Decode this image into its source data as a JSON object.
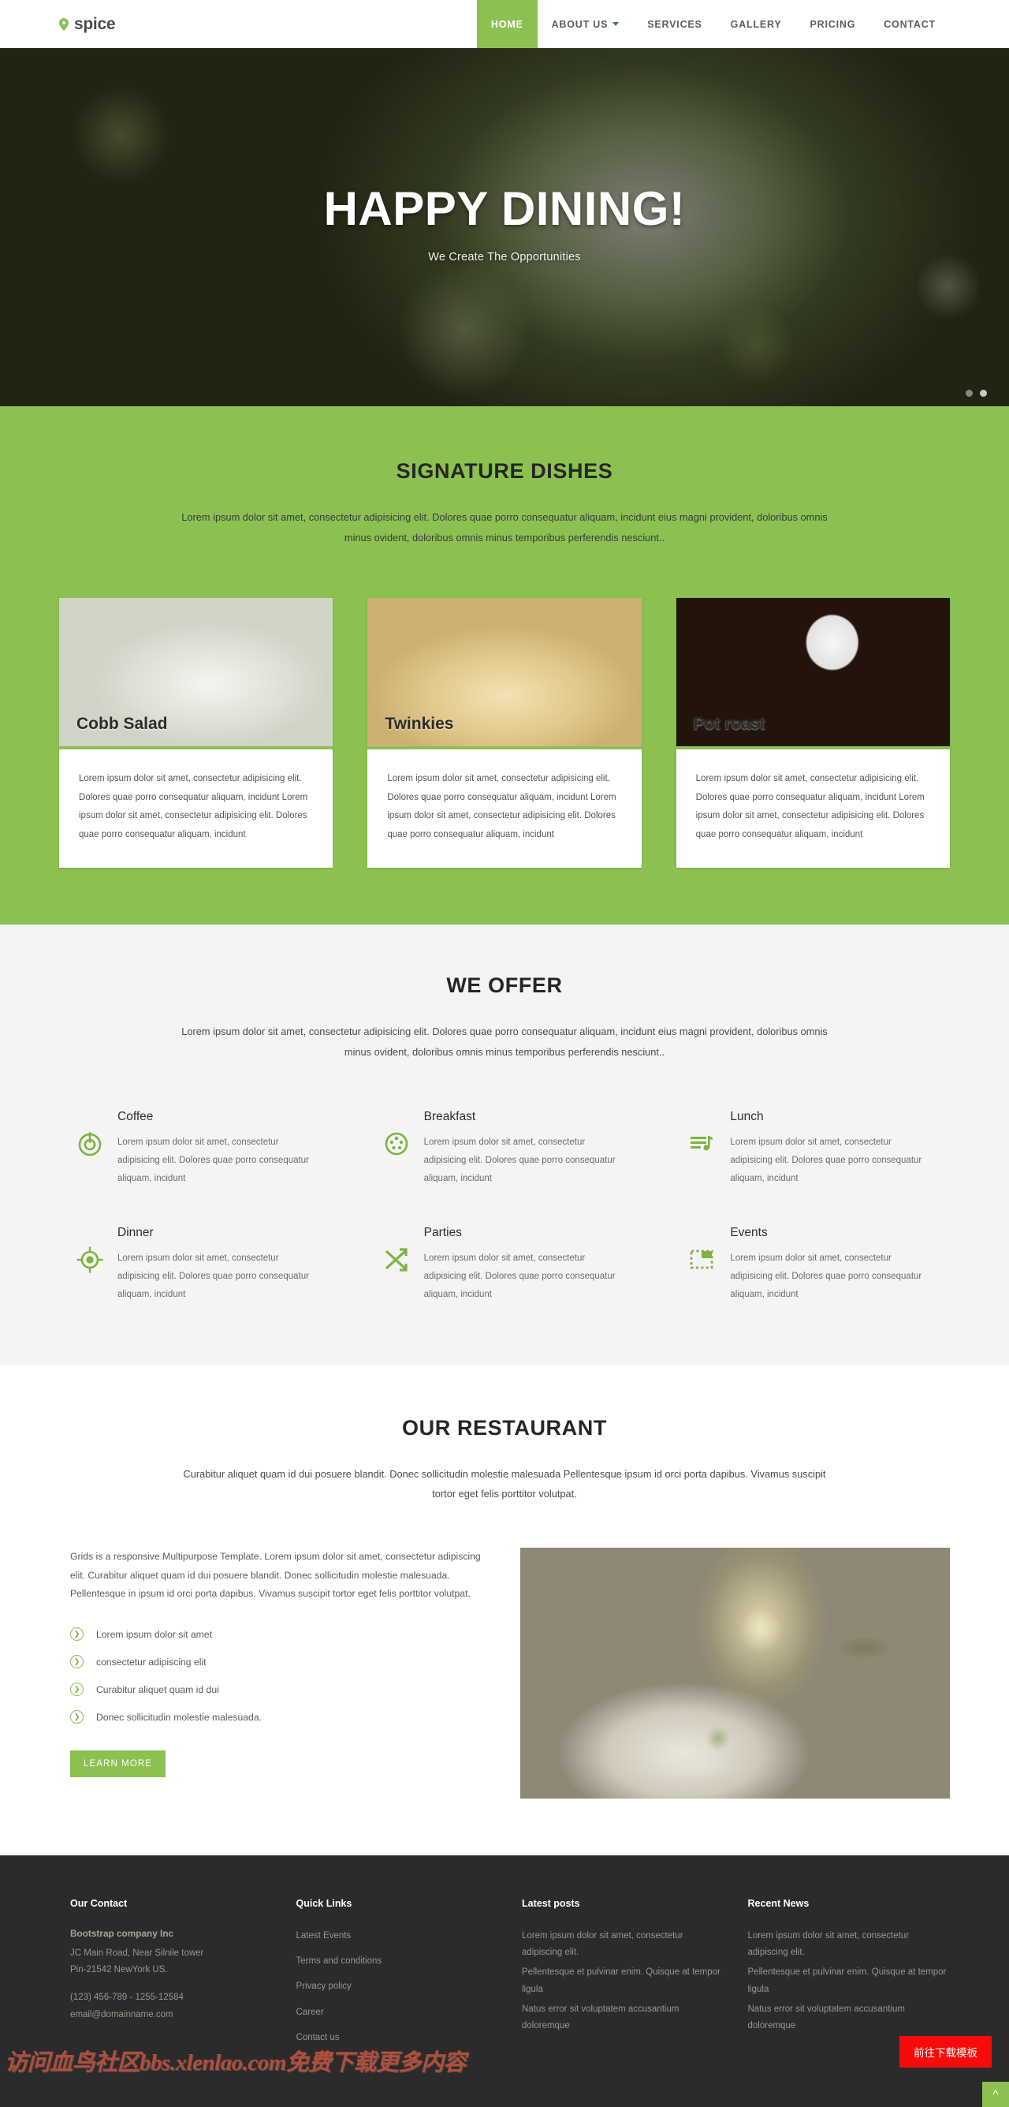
{
  "brand": {
    "name": "spice",
    "icon": "map-pin-icon"
  },
  "nav": {
    "items": [
      {
        "label": "HOME",
        "active": true
      },
      {
        "label": "ABOUT US",
        "caret": true
      },
      {
        "label": "SERVICES"
      },
      {
        "label": "GALLERY"
      },
      {
        "label": "PRICING"
      },
      {
        "label": "CONTACT"
      }
    ]
  },
  "hero": {
    "title": "HAPPY DINING!",
    "subtitle": "We Create The Opportunities",
    "dots": 2
  },
  "dishes": {
    "title": "SIGNATURE DISHES",
    "subtitle": "Lorem ipsum dolor sit amet, consectetur adipisicing elit. Dolores quae porro consequatur aliquam, incidunt eius magni provident, doloribus omnis minus ovident, doloribus omnis minus temporibus perferendis nesciunt..",
    "cards": [
      {
        "name": "Cobb Salad",
        "body": "Lorem ipsum dolor sit amet, consectetur adipisicing elit. Dolores quae porro consequatur aliquam, incidunt Lorem ipsum dolor sit amet, consectetur adipisicing elit. Dolores quae porro consequatur aliquam, incidunt"
      },
      {
        "name": "Twinkies",
        "body": "Lorem ipsum dolor sit amet, consectetur adipisicing elit. Dolores quae porro consequatur aliquam, incidunt Lorem ipsum dolor sit amet, consectetur adipisicing elit. Dolores quae porro consequatur aliquam, incidunt"
      },
      {
        "name": "Pot roast",
        "body": "Lorem ipsum dolor sit amet, consectetur adipisicing elit. Dolores quae porro consequatur aliquam, incidunt Lorem ipsum dolor sit amet, consectetur adipisicing elit. Dolores quae porro consequatur aliquam, incidunt"
      }
    ]
  },
  "offer": {
    "title": "WE OFFER",
    "subtitle": "Lorem ipsum dolor sit amet, consectetur adipisicing elit. Dolores quae porro consequatur aliquam, incidunt eius magni provident, doloribus omnis minus ovident, doloribus omnis minus temporibus perferendis nesciunt..",
    "items": [
      {
        "title": "Coffee",
        "icon": "power-circle-icon",
        "body": "Lorem ipsum dolor sit amet, consectetur adipisicing elit. Dolores quae porro consequatur aliquam, incidunt"
      },
      {
        "title": "Breakfast",
        "icon": "dotted-circle-icon",
        "body": "Lorem ipsum dolor sit amet, consectetur adipisicing elit. Dolores quae porro consequatur aliquam, incidunt"
      },
      {
        "title": "Lunch",
        "icon": "playlist-music-icon",
        "body": "Lorem ipsum dolor sit amet, consectetur adipisicing elit. Dolores quae porro consequatur aliquam, incidunt"
      },
      {
        "title": "Dinner",
        "icon": "target-icon",
        "body": "Lorem ipsum dolor sit amet, consectetur adipisicing elit. Dolores quae porro consequatur aliquam, incidunt"
      },
      {
        "title": "Parties",
        "icon": "shuffle-icon",
        "body": "Lorem ipsum dolor sit amet, consectetur adipisicing elit. Dolores quae porro consequatur aliquam, incidunt"
      },
      {
        "title": "Events",
        "icon": "crop-dashed-icon",
        "body": "Lorem ipsum dolor sit amet, consectetur adipisicing elit. Dolores quae porro consequatur aliquam, incidunt"
      }
    ]
  },
  "restaurant": {
    "title": "OUR RESTAURANT",
    "subtitle": "Curabitur aliquet quam id dui posuere blandit. Donec sollicitudin molestie malesuada Pellentesque ipsum id orci porta dapibus. Vivamus suscipit tortor eget felis porttitor volutpat.",
    "paragraph": "Grids is a responsive Multipurpose Template. Lorem ipsum dolor sit amet, consectetur adipiscing elit. Curabitur aliquet quam id dui posuere blandit. Donec sollicitudin molestie malesuada. Pellentesque in ipsum id orci porta dapibus. Vivamus suscipit tortor eget felis porttitor volutpat.",
    "list": [
      "Lorem ipsum dolor sit amet",
      "consectetur adipiscing elit",
      "Curabitur aliquet quam id dui",
      "Donec sollicitudin molestie malesuada."
    ],
    "button": "LEARN MORE"
  },
  "footer": {
    "contact": {
      "heading": "Our Contact",
      "company": "Bootstrap company Inc",
      "address_line1": "JC Main Road, Near Silnile tower",
      "address_line2": "Pin-21542 NewYork US.",
      "phone": "(123) 456-789 - 1255-12584",
      "email": "email@domainname.com"
    },
    "quick_links": {
      "heading": "Quick Links",
      "links": [
        "Latest Events",
        "Terms and conditions",
        "Privacy policy",
        "Career",
        "Contact us"
      ]
    },
    "latest_posts": {
      "heading": "Latest posts",
      "posts": [
        "Lorem ipsum dolor sit amet, consectetur adipiscing elit.",
        "Pellentesque et pulvinar enim. Quisque at tempor ligula",
        "Natus error sit voluptatem accusantium doloremque"
      ]
    },
    "recent_news": {
      "heading": "Recent News",
      "posts": [
        "Lorem ipsum dolor sit amet, consectetur adipiscing elit.",
        "Pellentesque et pulvinar enim. Quisque at tempor ligula",
        "Natus error sit voluptatem accusantium doloremque"
      ]
    }
  },
  "overlay": {
    "watermark": "访问血鸟社区bbs.xlenlao.com免费下载更多内容",
    "download_button": "前往下载模板",
    "to_top_icon": "chevron-up-icon"
  },
  "colors": {
    "accent_green": "#8cc152",
    "footer_bg": "#2b2b2b",
    "offer_bg": "#f4f4f4",
    "alert_red": "#f60b0b"
  }
}
